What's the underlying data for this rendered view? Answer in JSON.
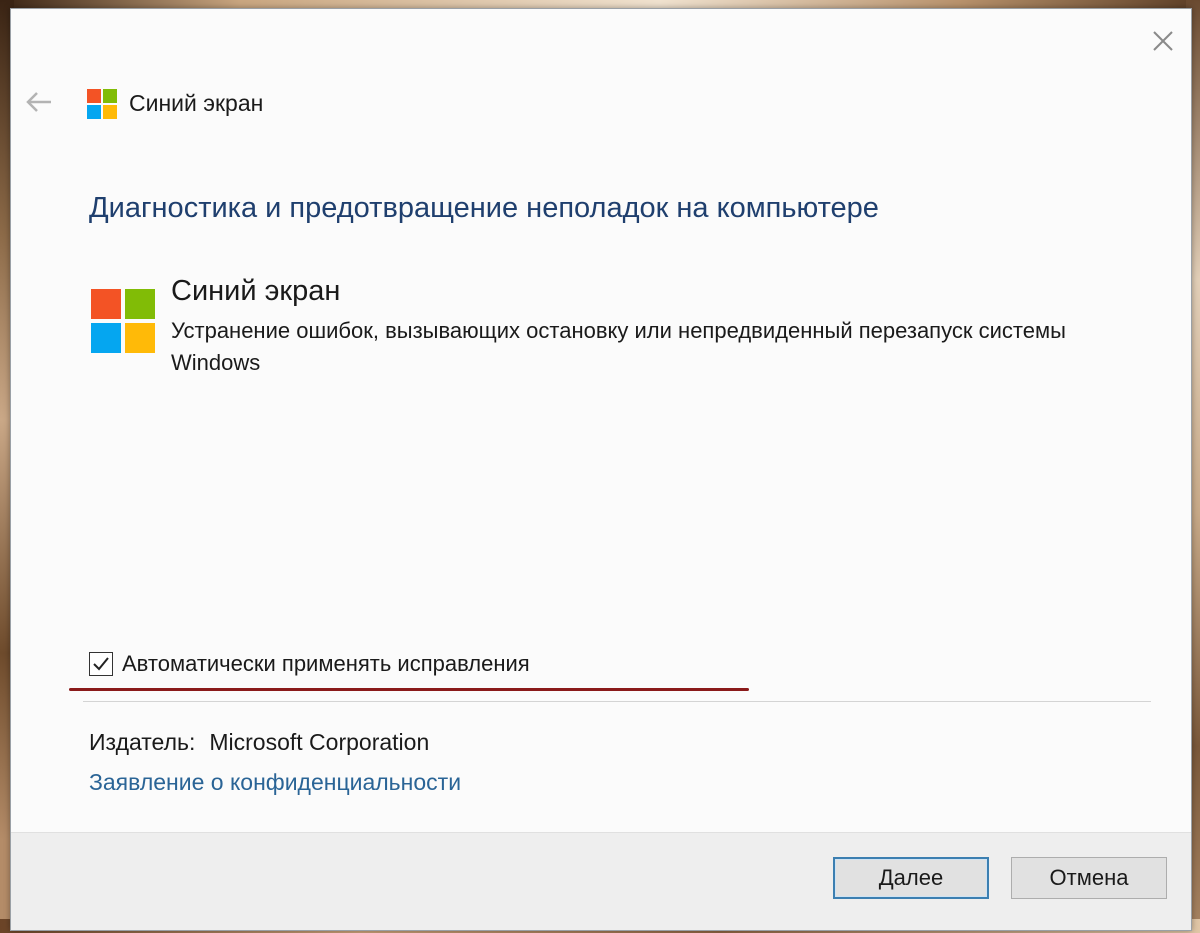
{
  "window": {
    "title": "Синий экран",
    "heading": "Диагностика и предотвращение неполадок на компьютере"
  },
  "troubleshooter": {
    "title": "Синий экран",
    "description": "Устранение ошибок, вызывающих остановку или непредвиденный перезапуск системы Windows"
  },
  "options": {
    "auto_apply_label": "Автоматически применять исправления",
    "auto_apply_checked": true
  },
  "publisher": {
    "label": "Издатель:",
    "value": "Microsoft Corporation"
  },
  "privacy_link": "Заявление о конфиденциальности",
  "buttons": {
    "next": "Далее",
    "cancel": "Отмена"
  },
  "icons": {
    "close": "close-icon",
    "back": "back-arrow-icon",
    "logo": "windows-logo-icon",
    "check": "checkmark-icon"
  },
  "colors": {
    "logo_red": "#f35325",
    "logo_green": "#81bc06",
    "logo_blue": "#05a6f0",
    "logo_yellow": "#ffba08",
    "heading": "#1f3f6e",
    "link": "#2a6496",
    "annotation_underline": "#8a1a1a"
  }
}
